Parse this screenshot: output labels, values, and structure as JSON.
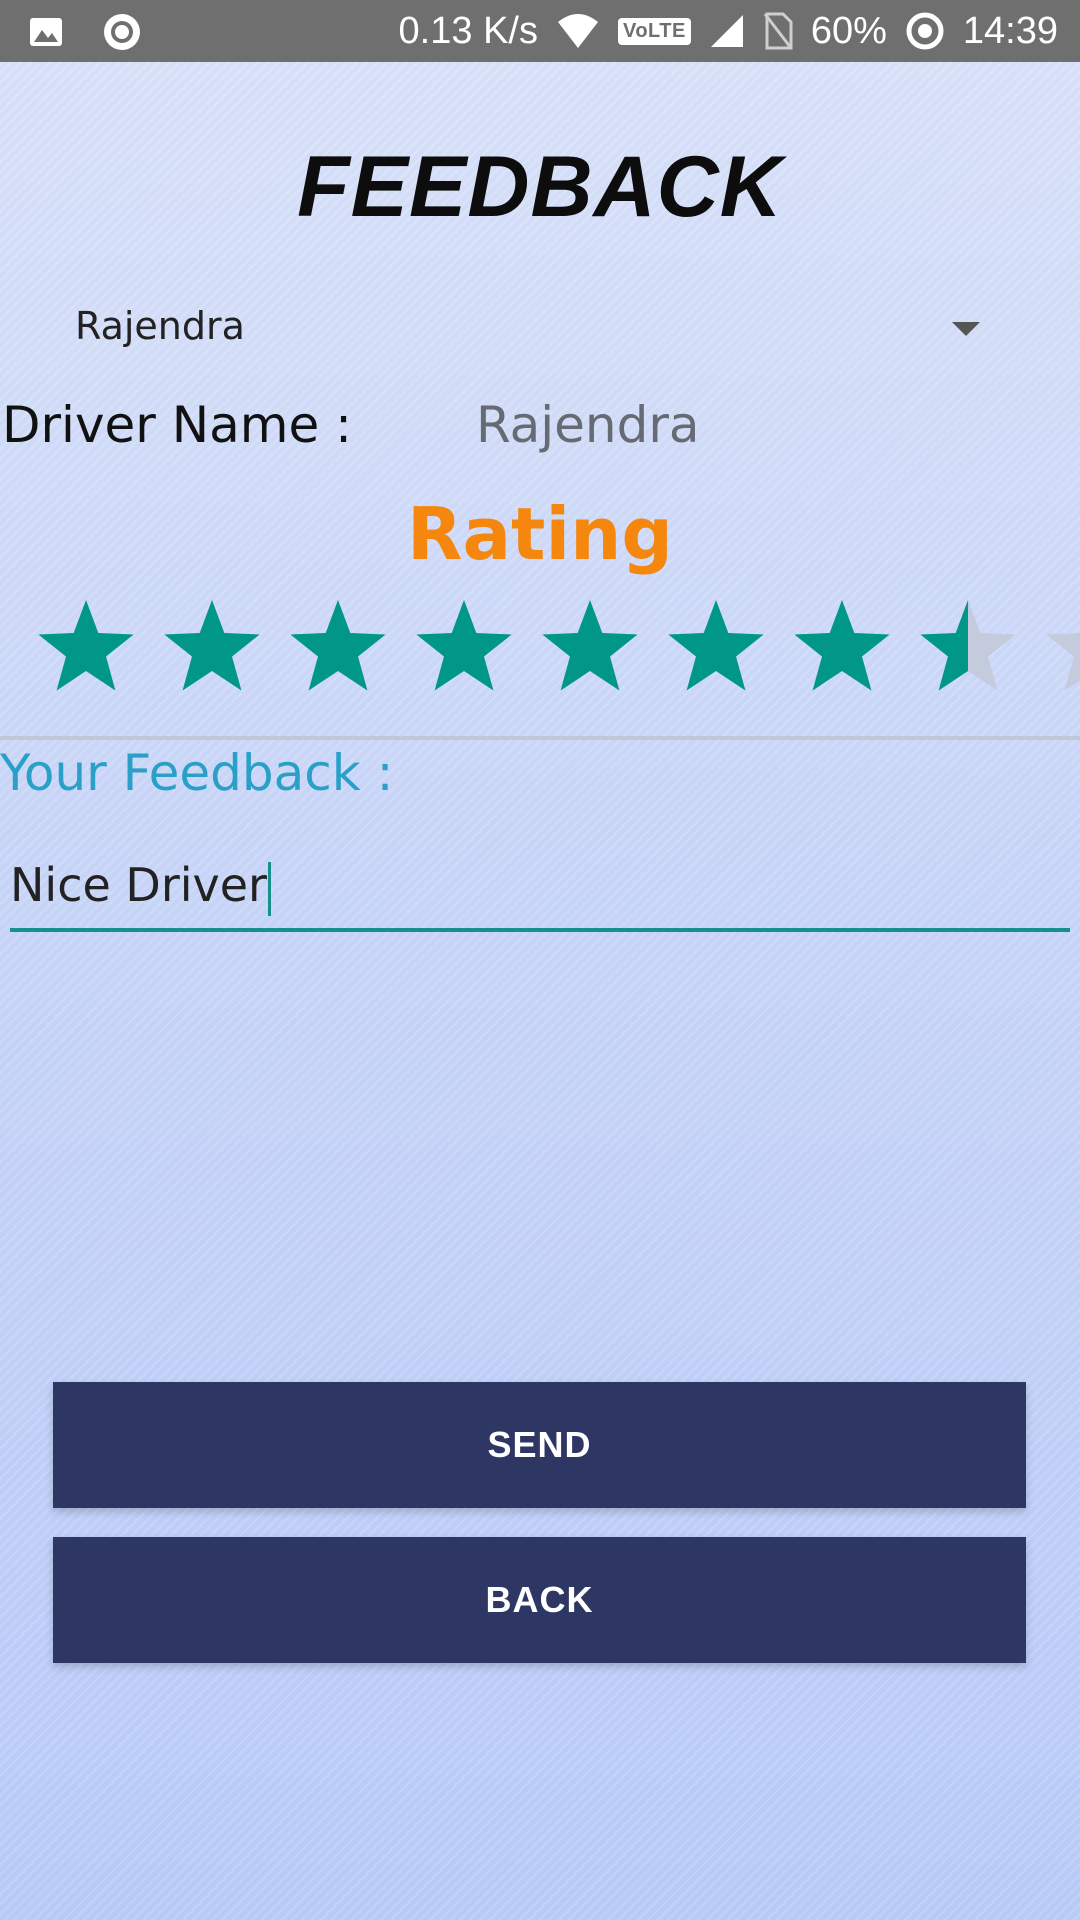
{
  "status_bar": {
    "speed": "0.13 K/s",
    "lte": "VoLTE",
    "battery": "60%",
    "time": "14:39",
    "icons": [
      "gallery-icon",
      "record-icon",
      "wifi-icon",
      "signal-icon",
      "no-sim-icon",
      "battery-icon"
    ]
  },
  "page": {
    "title": "FEEDBACK"
  },
  "driver_select": {
    "selected": "Rajendra"
  },
  "driver": {
    "label": "Driver Name :",
    "value": "Rajendra"
  },
  "rating": {
    "label": "Rating",
    "value": 7.5,
    "max_visible": 8,
    "colors": {
      "filled": "#009688",
      "empty": "#c3cbdc"
    }
  },
  "feedback": {
    "label": "Your Feedback :",
    "value": "Nice Driver"
  },
  "buttons": {
    "send": "SEND",
    "back": "BACK"
  },
  "colors": {
    "title": "#0d0d0d",
    "rating_label": "#f5870f",
    "feedback_label": "#2aa0c8",
    "button_bg": "#2e3763",
    "accent_teal": "#178f8a"
  }
}
